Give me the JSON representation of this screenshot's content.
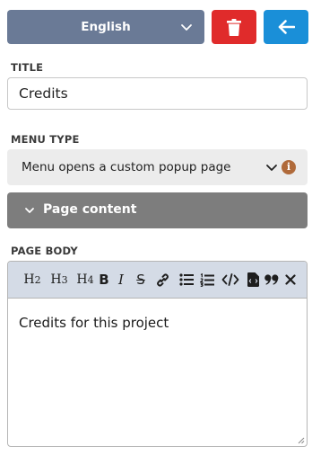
{
  "header": {
    "language": "English",
    "delete_icon": "trash-icon",
    "back_icon": "arrow-left-icon",
    "colors": {
      "language_bg": "#6a7a96",
      "delete_bg": "#e02b2b",
      "back_bg": "#1a8fd8"
    }
  },
  "title_field": {
    "label": "TITLE",
    "value": "Credits"
  },
  "menu_type": {
    "label": "MENU TYPE",
    "selected": "Menu opens a custom popup page",
    "info_icon": "info-icon"
  },
  "section": {
    "label": "Page content",
    "icon": "chevron-down-icon"
  },
  "page_body": {
    "label": "PAGE BODY",
    "toolbar": {
      "h2": "H",
      "h2_sub": "2",
      "h3": "H",
      "h3_sub": "3",
      "h4": "H",
      "h4_sub": "4",
      "bold": "B",
      "italic": "I",
      "strike": "S",
      "icons": [
        "link-icon",
        "bullet-list-icon",
        "numbered-list-icon",
        "code-icon",
        "file-icon",
        "quote-icon",
        "clear-icon"
      ]
    },
    "content": "Credits for this project"
  }
}
